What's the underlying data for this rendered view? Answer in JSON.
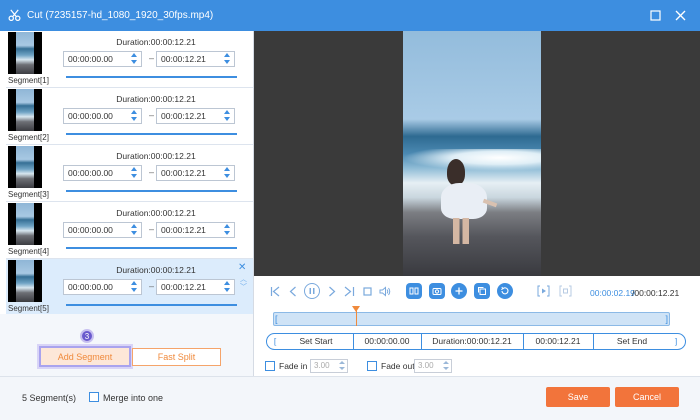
{
  "window": {
    "title": "Cut (7235157-hd_1080_1920_30fps.mp4)",
    "icons": {
      "app": "scissors-icon",
      "maximize": "maximize-icon",
      "close": "close-icon"
    }
  },
  "segments": [
    {
      "label": "Segment[1]",
      "duration": "Duration:00:00:12.21",
      "start": "00:00:00.00",
      "end": "00:00:12.21"
    },
    {
      "label": "Segment[2]",
      "duration": "Duration:00:00:12.21",
      "start": "00:00:00.00",
      "end": "00:00:12.21"
    },
    {
      "label": "Segment[3]",
      "duration": "Duration:00:00:12.21",
      "start": "00:00:00.00",
      "end": "00:00:12.21"
    },
    {
      "label": "Segment[4]",
      "duration": "Duration:00:00:12.21",
      "start": "00:00:00.00",
      "end": "00:00:12.21"
    },
    {
      "label": "Segment[5]",
      "duration": "Duration:00:00:12.21",
      "start": "00:00:00.00",
      "end": "00:00:12.21"
    }
  ],
  "segment_separator": "–",
  "actions": {
    "step_badge": "3",
    "add_segment": "Add Segment",
    "fast_split": "Fast Split"
  },
  "player": {
    "current_time": "00:00:02.19",
    "total_time": "/00:00:12.21",
    "playhead_fraction": 0.21,
    "icons": [
      "skip-to-start-icon",
      "previous-frame-icon",
      "pause-icon",
      "next-frame-icon",
      "skip-to-end-icon",
      "stop-icon",
      "volume-icon",
      "split-icon",
      "snapshot-icon",
      "add-icon",
      "copy-icon",
      "reset-icon",
      "loop-play-icon",
      "fullscreen-icon"
    ]
  },
  "edit": {
    "set_start": "Set Start",
    "start_time": "00:00:00.00",
    "duration": "Duration:00:00:12.21",
    "end_time": "00:00:12.21",
    "set_end": "Set End"
  },
  "fade": {
    "fade_in_label": "Fade in",
    "fade_in_value": "3.00",
    "fade_out_label": "Fade out",
    "fade_out_value": "3.00"
  },
  "footer": {
    "segment_count": "5 Segment(s)",
    "merge_label": "Merge into one",
    "save": "Save",
    "cancel": "Cancel"
  },
  "colors": {
    "accent": "#3d8ee0",
    "orange": "#f2743b",
    "active_row": "#dcecfc"
  }
}
